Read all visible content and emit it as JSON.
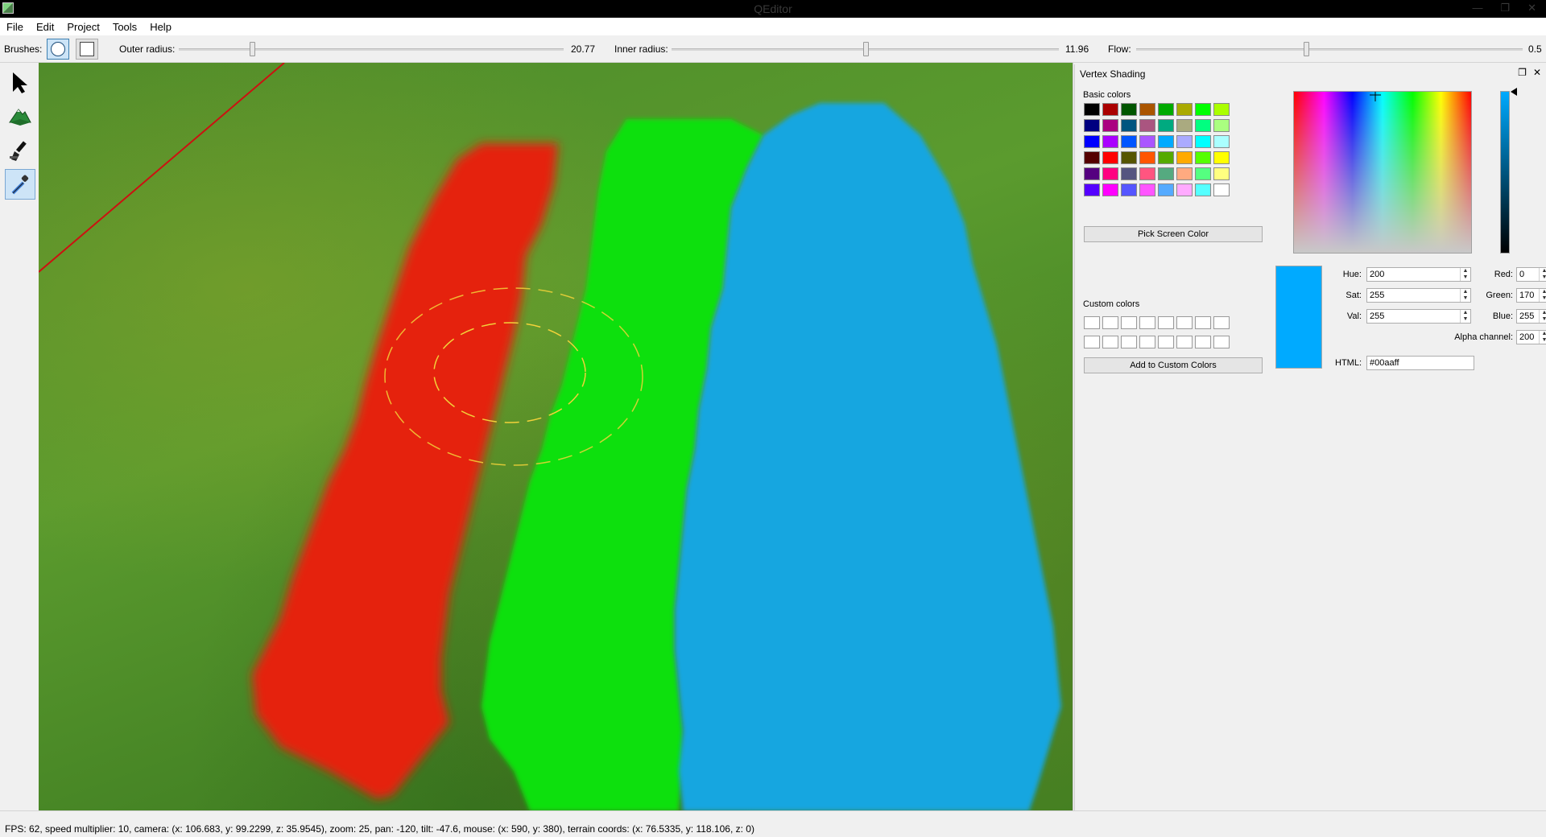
{
  "window": {
    "title": "QEditor",
    "controls": [
      "—",
      "❐",
      "✕"
    ]
  },
  "menu": [
    "File",
    "Edit",
    "Project",
    "Tools",
    "Help"
  ],
  "toolbar": {
    "brushes_label": "Brushes:",
    "outer_radius_label": "Outer radius:",
    "outer_radius_value": "20.77",
    "outer_radius_slider_fraction": 0.19,
    "inner_radius_label": "Inner radius:",
    "inner_radius_value": "11.96",
    "inner_radius_slider_fraction": 0.5,
    "flow_label": "Flow:",
    "flow_value": "0.5",
    "flow_slider_fraction": 0.44
  },
  "tools": [
    "select-arrow-icon",
    "terrain-mountain-icon",
    "paint-brush-icon",
    "eyedropper-icon"
  ],
  "viewport": {
    "stripes": [
      {
        "name": "red",
        "color": "#e5200d"
      },
      {
        "name": "green",
        "color": "#11e00f"
      },
      {
        "name": "blue",
        "color": "#12a6e0"
      }
    ]
  },
  "dock": {
    "title": "Vertex Shading",
    "basic_colors_label": "Basic colors",
    "basic_colors": [
      [
        "#000000",
        "#aa0000",
        "#005500",
        "#aa5500",
        "#00aa00",
        "#aaaa00",
        "#00ff00",
        "#aaff00"
      ],
      [
        "#000080",
        "#aa0080",
        "#005580",
        "#aa5580",
        "#00aa80",
        "#aaaa80",
        "#00ff80",
        "#aaff80"
      ],
      [
        "#0000ff",
        "#aa00ff",
        "#0055ff",
        "#aa55ff",
        "#00aaff",
        "#aaaaff",
        "#00ffff",
        "#aaffff"
      ],
      [
        "#550000",
        "#ff0000",
        "#555500",
        "#ff5500",
        "#55aa00",
        "#ffaa00",
        "#55ff00",
        "#ffff00"
      ],
      [
        "#550080",
        "#ff0080",
        "#555580",
        "#ff5580",
        "#55aa80",
        "#ffaa80",
        "#55ff80",
        "#ffff80"
      ],
      [
        "#5500ff",
        "#ff00ff",
        "#5555ff",
        "#ff55ff",
        "#55aaff",
        "#ffaaff",
        "#55ffff",
        "#ffffff"
      ]
    ],
    "pick_screen_color": "Pick Screen Color",
    "custom_colors_label": "Custom colors",
    "add_custom": "Add to Custom Colors",
    "fields": {
      "hue_label": "Hue:",
      "hue": "200",
      "sat_label": "Sat:",
      "sat": "255",
      "val_label": "Val:",
      "val": "255",
      "red_label": "Red:",
      "red": "0",
      "green_label": "Green:",
      "green": "170",
      "blue_label": "Blue:",
      "blue": "255",
      "alpha_label": "Alpha channel:",
      "alpha": "200",
      "html_label": "HTML:",
      "html": "#00aaff"
    },
    "current_color": "#00aaff"
  },
  "status": "FPS: 62, speed multiplier: 10, camera: (x: 106.683, y: 99.2299, z: 35.9545), zoom: 25, pan: -120, tilt: -47.6, mouse: (x: 590, y: 380), terrain coords: (x: 76.5335, y: 118.106, z: 0)"
}
